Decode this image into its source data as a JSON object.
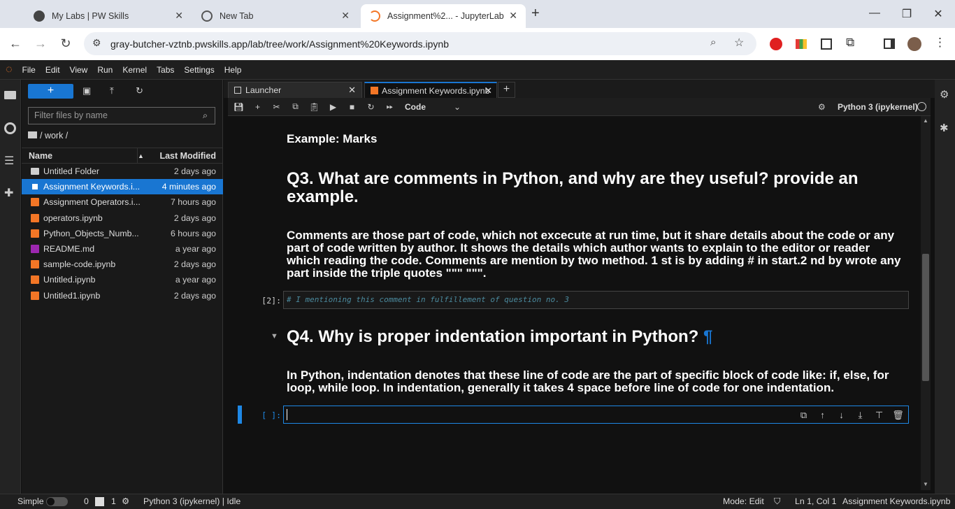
{
  "browser": {
    "tabs": [
      {
        "title": "My Labs | PW Skills"
      },
      {
        "title": "New Tab"
      },
      {
        "title": "Assignment%2... - JupyterLab"
      }
    ],
    "url": "gray-butcher-vztnb.pwskills.app/lab/tree/work/Assignment%20Keywords.ipynb"
  },
  "menubar": [
    "File",
    "Edit",
    "View",
    "Run",
    "Kernel",
    "Tabs",
    "Settings",
    "Help"
  ],
  "file_browser": {
    "new_label": "+",
    "filter_placeholder": "Filter files by name",
    "breadcrumb": "/ work /",
    "col_name": "Name",
    "col_modified": "Last Modified",
    "files": [
      {
        "name": "Untitled Folder",
        "modified": "2 days ago",
        "type": "folder"
      },
      {
        "name": "Assignment Keywords.i...",
        "modified": "4 minutes ago",
        "type": "notebook-open",
        "selected": true
      },
      {
        "name": "Assignment Operators.i...",
        "modified": "7 hours ago",
        "type": "notebook"
      },
      {
        "name": "operators.ipynb",
        "modified": "2 days ago",
        "type": "notebook"
      },
      {
        "name": "Python_Objects_Numb...",
        "modified": "6 hours ago",
        "type": "notebook"
      },
      {
        "name": "README.md",
        "modified": "a year ago",
        "type": "markdown"
      },
      {
        "name": "sample-code.ipynb",
        "modified": "2 days ago",
        "type": "notebook"
      },
      {
        "name": "Untitled.ipynb",
        "modified": "a year ago",
        "type": "notebook"
      },
      {
        "name": "Untitled1.ipynb",
        "modified": "2 days ago",
        "type": "notebook"
      }
    ]
  },
  "dock_tabs": [
    {
      "label": "Launcher"
    },
    {
      "label": "Assignment Keywords.ipynb"
    }
  ],
  "notebook_toolbar": {
    "cell_type": "Code",
    "kernel": "Python 3 (ipykernel)"
  },
  "cells": {
    "example": "Example: Marks",
    "q3_heading": "Q3. What are comments in Python, and why are they useful? provide an example.",
    "q3_answer": "Comments are those part of code, which not excecute at run time, but it share details about the code or any part of code written by author. It shows the details which author wants to explain to the editor or reader which reading the code. Comments are mention by two method. 1 st is by adding # in start.2 nd by wrote any part inside the triple quotes \"\"\" \"\"\".",
    "code_prompt": "[2]:",
    "code_text": "# I mentioning this comment in fulfillement of question no. 3",
    "q4_heading": "Q4. Why is proper indentation important in Python?",
    "anchor": "¶",
    "q4_answer": "In Python, indentation denotes that these line of code are the part of specific block of code like: if, else, for loop, while loop. In indentation, generally it takes 4 space before line of code for one indentation.",
    "empty_prompt": "[ ]:"
  },
  "statusbar": {
    "mode_label": "Simple",
    "count0": "0",
    "count1": "1",
    "kernel_status": "Python 3 (ipykernel) | Idle",
    "mode": "Mode: Edit",
    "position": "Ln 1, Col 1",
    "filename": "Assignment Keywords.ipynb"
  },
  "colors": {
    "accent": "#1976d2",
    "notebook_icon": "#f37626",
    "markdown_icon": "#9c27b0"
  }
}
